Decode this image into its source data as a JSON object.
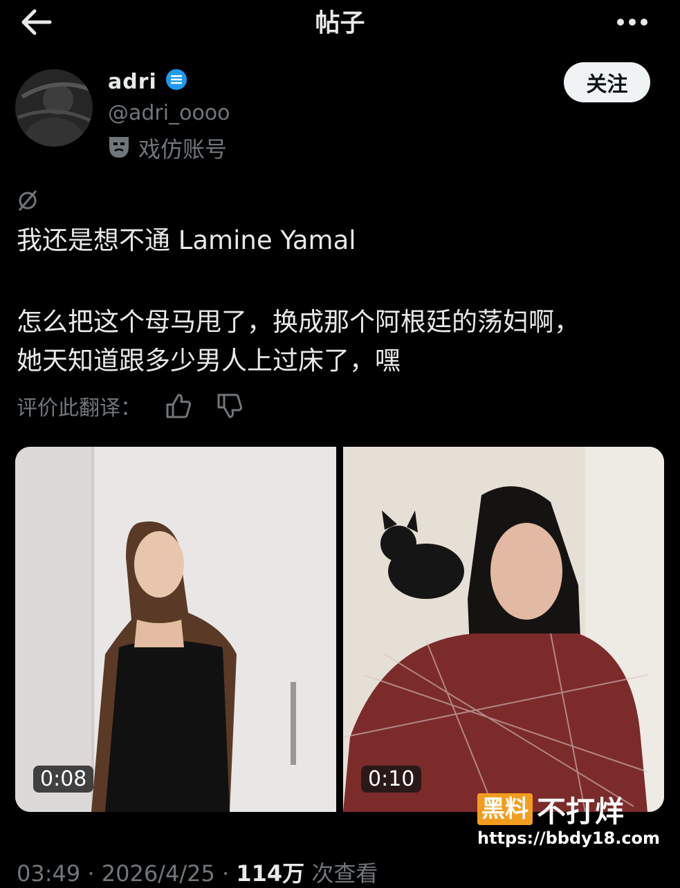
{
  "header": {
    "title": "帖子"
  },
  "author": {
    "username": "adri",
    "handle": "@adri_oooo",
    "badge_label": "戏仿账号",
    "follow_label": "关注",
    "verified_color": "#1d9bf0"
  },
  "post": {
    "line1": "我还是想不通 Lamine Yamal",
    "line2": "怎么把这个母马甩了，换成那个阿根廷的荡妇啊，",
    "line3": "她天知道跟多少男人上过床了，嘿",
    "rate_label": "评价此翻译："
  },
  "media": [
    {
      "duration": "0:08"
    },
    {
      "duration": "0:10"
    }
  ],
  "watermark": {
    "box": "黑料",
    "text": "不打烊",
    "url": "https://bbdy18.com"
  },
  "meta": {
    "time": "03:49",
    "date": "2026/4/25",
    "views": "114万",
    "views_label": "次查看"
  }
}
